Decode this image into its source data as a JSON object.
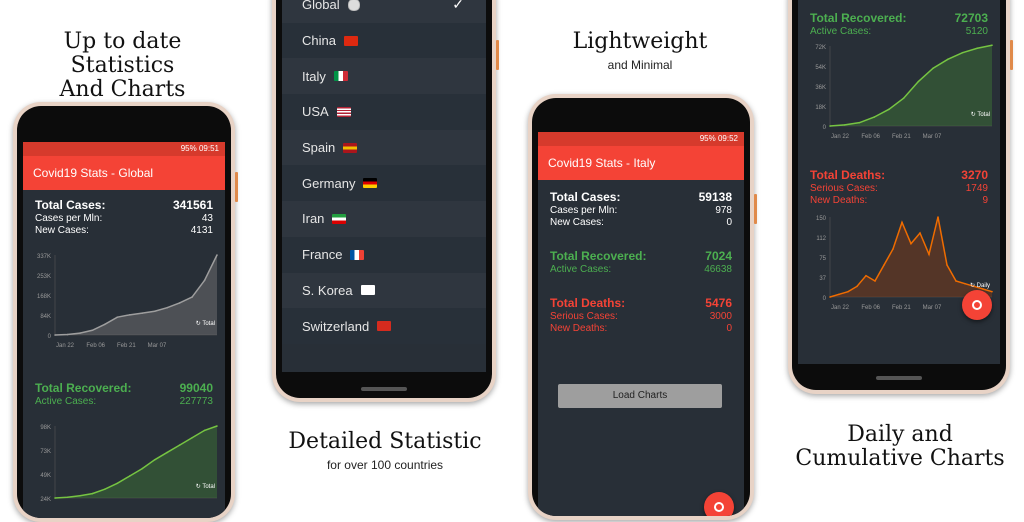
{
  "captions": {
    "c1_line1": "Up to date Statistics",
    "c1_line2": "And Charts",
    "c2_title": "Detailed Statistic",
    "c2_sub": "for over 100 countries",
    "c3_title": "Lightweight",
    "c3_sub": "and Minimal",
    "c4_line1": "Daily and",
    "c4_line2": "Cumulative Charts"
  },
  "colors": {
    "accent": "#f44336",
    "green": "#4caf50",
    "bg": "#282f37"
  },
  "phone1": {
    "status": "95% 09:51",
    "title": "Covid19 Stats - Global",
    "total_cases_label": "Total Cases:",
    "total_cases": "341561",
    "cases_per_mln_label": "Cases per Mln:",
    "cases_per_mln": "43",
    "new_cases_label": "New Cases:",
    "new_cases": "4131",
    "total_recovered_label": "Total Recovered:",
    "total_recovered": "99040",
    "active_cases_label": "Active Cases:",
    "active_cases": "227773",
    "chart_toggle": "Total",
    "chart1_yticks": [
      "337K",
      "253K",
      "168K",
      "84K",
      "0"
    ],
    "chart1_xticks": [
      "Jan 22",
      "Feb 06",
      "Feb 21",
      "Mar 07"
    ],
    "chart2_yticks": [
      "98K",
      "73K",
      "49K",
      "24K"
    ]
  },
  "phone2": {
    "countries": [
      {
        "name": "Global",
        "icon": "globe-icon",
        "selected": true
      },
      {
        "name": "China",
        "icon": "flag-china-icon"
      },
      {
        "name": "Italy",
        "icon": "flag-italy-icon"
      },
      {
        "name": "USA",
        "icon": "flag-usa-icon"
      },
      {
        "name": "Spain",
        "icon": "flag-spain-icon"
      },
      {
        "name": "Germany",
        "icon": "flag-germany-icon"
      },
      {
        "name": "Iran",
        "icon": "flag-iran-icon"
      },
      {
        "name": "France",
        "icon": "flag-france-icon"
      },
      {
        "name": "S. Korea",
        "icon": "flag-korea-icon"
      },
      {
        "name": "Switzerland",
        "icon": "flag-switzerland-icon"
      }
    ]
  },
  "phone3": {
    "status": "95% 09:52",
    "title": "Covid19 Stats - Italy",
    "total_cases_label": "Total Cases:",
    "total_cases": "59138",
    "cases_per_mln_label": "Cases per Mln:",
    "cases_per_mln": "978",
    "new_cases_label": "New Cases:",
    "new_cases": "0",
    "total_recovered_label": "Total Recovered:",
    "total_recovered": "7024",
    "active_cases_label": "Active Cases:",
    "active_cases": "46638",
    "total_deaths_label": "Total Deaths:",
    "total_deaths": "5476",
    "serious_cases_label": "Serious Cases:",
    "serious_cases": "3000",
    "new_deaths_label": "New Deaths:",
    "new_deaths": "0",
    "load_button": "Load Charts"
  },
  "phone4": {
    "total_recovered_label": "Total Recovered:",
    "total_recovered": "72703",
    "active_cases_label": "Active Cases:",
    "active_cases": "5120",
    "total_deaths_label": "Total Deaths:",
    "total_deaths": "3270",
    "serious_cases_label": "Serious Cases:",
    "serious_cases": "1749",
    "new_deaths_label": "New Deaths:",
    "new_deaths": "9",
    "chart_toggle_total": "Total",
    "chart_toggle_daily": "Daily",
    "chart1_yticks": [
      "72K",
      "54K",
      "36K",
      "18K",
      "0"
    ],
    "chart2_yticks": [
      "150",
      "112",
      "75",
      "37",
      "0"
    ],
    "xticks": [
      "Jan 22",
      "Feb 06",
      "Feb 21",
      "Mar 07"
    ]
  },
  "chart_data": [
    {
      "type": "area",
      "title": "",
      "series": [
        {
          "values": [
            0,
            2,
            8,
            20,
            45,
            75,
            85,
            92,
            100,
            115,
            135,
            160,
            230,
            337
          ]
        }
      ],
      "ylim": [
        0,
        337
      ],
      "yunit": "K"
    },
    {
      "type": "area",
      "title": "",
      "series": [
        {
          "values": [
            0,
            1,
            3,
            6,
            12,
            20,
            30,
            40,
            52,
            62,
            72,
            82,
            92,
            98
          ]
        }
      ],
      "ylim": [
        0,
        98
      ],
      "yunit": "K"
    },
    {
      "type": "area",
      "title": "",
      "series": [
        {
          "values": [
            0,
            1,
            3,
            8,
            15,
            25,
            40,
            52,
            60,
            66,
            70,
            72.7
          ]
        }
      ],
      "ylim": [
        0,
        72
      ],
      "yunit": "K"
    },
    {
      "type": "area",
      "title": "",
      "series": [
        {
          "values": [
            0,
            5,
            10,
            20,
            40,
            30,
            60,
            90,
            140,
            100,
            120,
            80,
            150,
            60,
            30,
            25,
            20,
            15,
            10
          ]
        }
      ],
      "ylim": [
        0,
        150
      ]
    }
  ]
}
